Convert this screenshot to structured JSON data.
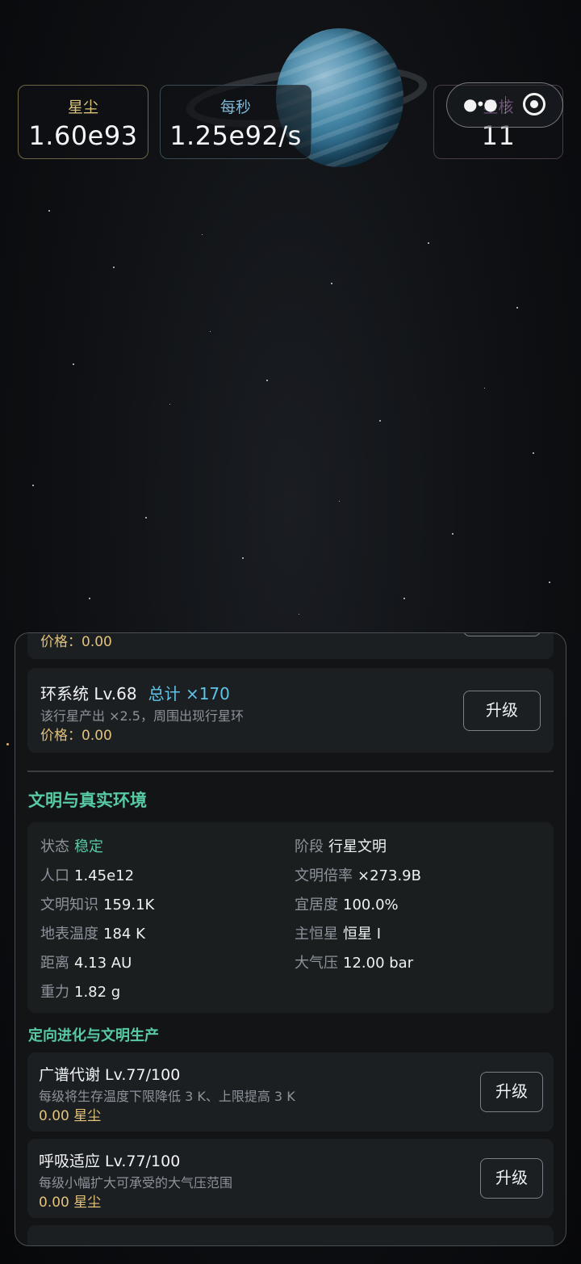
{
  "stats": {
    "stardust": {
      "label": "星尘",
      "value": "1.60e93"
    },
    "per_second": {
      "label": "每秒",
      "value": "1.25e92/s"
    },
    "core": {
      "label": "星核",
      "value": "11"
    }
  },
  "capsule": {
    "menu_icon": "more-dots-icon",
    "target_icon": "target-icon"
  },
  "panel": {
    "partial_card": {
      "price": "价格：0.00"
    },
    "ring_card": {
      "title": "环系统 Lv.68",
      "total": "总计 ×170",
      "desc": "该行星产出 ×2.5，周围出现行星环",
      "price": "价格：0.00",
      "button": "升级"
    },
    "civ_section": {
      "title": "文明与真实环境",
      "items": [
        {
          "key": "状态",
          "value": "稳定"
        },
        {
          "key": "阶段",
          "value": "行星文明"
        },
        {
          "key": "人口",
          "value": "1.45e12"
        },
        {
          "key": "文明倍率",
          "value": "×273.9B"
        },
        {
          "key": "文明知识",
          "value": "159.1K"
        },
        {
          "key": "宜居度",
          "value": "100.0%"
        },
        {
          "key": "地表温度",
          "value": "184 K"
        },
        {
          "key": "主恒星",
          "value": "恒星 I"
        },
        {
          "key": "距离",
          "value": "4.13 AU"
        },
        {
          "key": "大气压",
          "value": "12.00 bar"
        },
        {
          "key": "重力",
          "value": "1.82 g"
        }
      ]
    },
    "evo_section": {
      "title": "定向进化与文明生产",
      "cards": [
        {
          "title": "广谱代谢 Lv.77/100",
          "desc": "每级将生存温度下限降低 3 K、上限提高 3 K",
          "cost": "0.00 星尘",
          "button": "升级"
        },
        {
          "title": "呼吸适应 Lv.77/100",
          "desc": "每级小幅扩大可承受的大气压范围",
          "cost": "0.00 星尘",
          "button": "升级"
        }
      ]
    }
  }
}
